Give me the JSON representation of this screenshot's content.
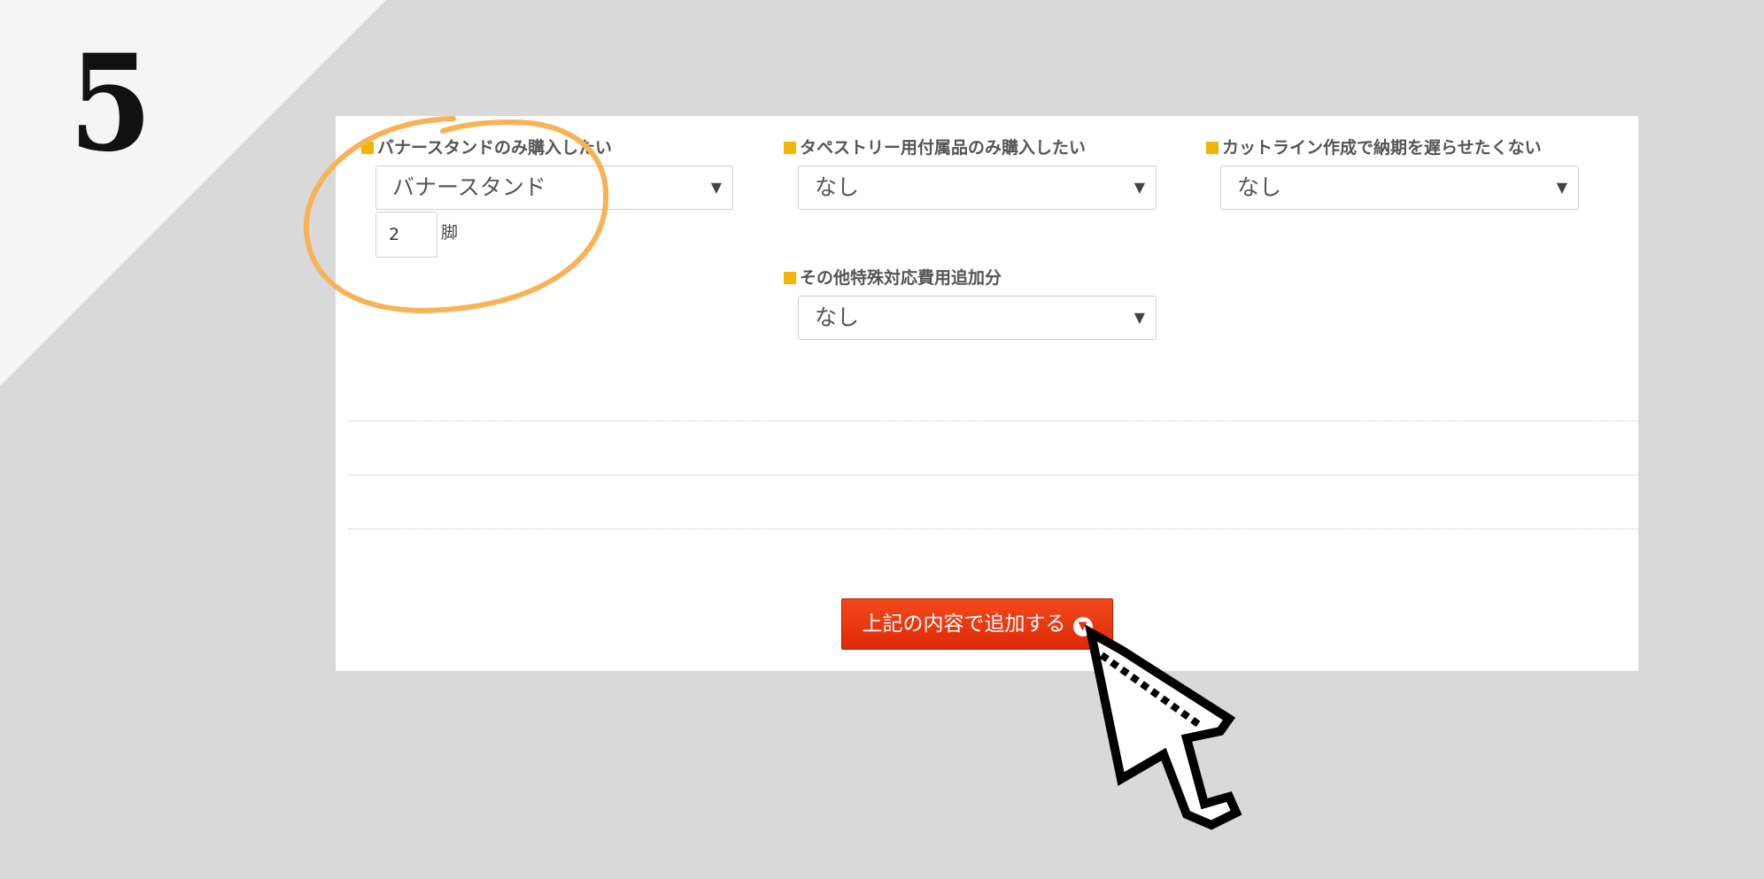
{
  "step_number": "5",
  "form": {
    "banner_stand": {
      "label": "バナースタンドのみ購入したい",
      "selected": "バナースタンド",
      "quantity": "2",
      "unit": "脚"
    },
    "tapestry_accessory": {
      "label": "タペストリー用付属品のみ購入したい",
      "selected": "なし"
    },
    "cutline": {
      "label": "カットライン作成で納期を遅らせたくない",
      "selected": "なし"
    },
    "special_fee": {
      "label": "その他特殊対応費用追加分",
      "selected": "なし"
    }
  },
  "submit_label": "上記の内容で追加する",
  "icons": {
    "caret": "▼",
    "submit_icon": "chevron-down-circle-icon"
  },
  "colors": {
    "accent_bullet": "#f5b400",
    "button": "#e62f0e",
    "highlight_circle": "#f7b355"
  }
}
